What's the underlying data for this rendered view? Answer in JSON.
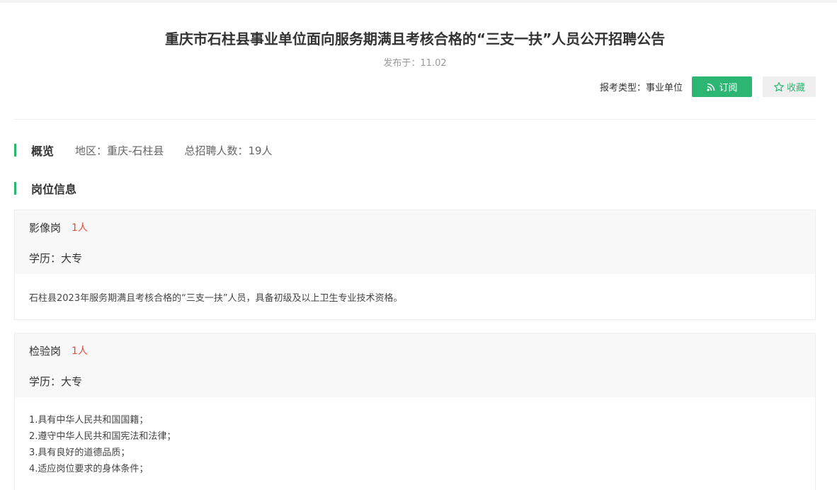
{
  "notice": {
    "title": "重庆市石柱县事业单位面向服务期满且考核合格的“三支一扶”人员公开招聘公告",
    "published": "发布于：11.02",
    "type_label": "报考类型：事业单位",
    "subscribe_label": "订阅",
    "favorite_label": "收藏"
  },
  "overview": {
    "heading": "概览",
    "region": "地区：重庆-石柱县",
    "total": "总招聘人数：19人"
  },
  "positions": {
    "heading": "岗位信息",
    "items": [
      {
        "name": "影像岗",
        "count": "1人",
        "education": "学历：大专",
        "requirements": [
          "石柱县2023年服务期满且考核合格的“三支一扶”人员，具备初级及以上卫生专业技术资格。"
        ]
      },
      {
        "name": "检验岗",
        "count": "1人",
        "education": "学历：大专",
        "requirements": [
          "1.具有中华人民共和国国籍；",
          "2.遵守中华人民共和国宪法和法律；",
          "3.具有良好的道德品质；",
          "4.适应岗位要求的身体条件；"
        ]
      }
    ]
  },
  "colors": {
    "accent": "#2bb673",
    "count": "#e64a3b"
  },
  "icons": {
    "subscribe": "rss-icon",
    "favorite": "star-icon"
  }
}
